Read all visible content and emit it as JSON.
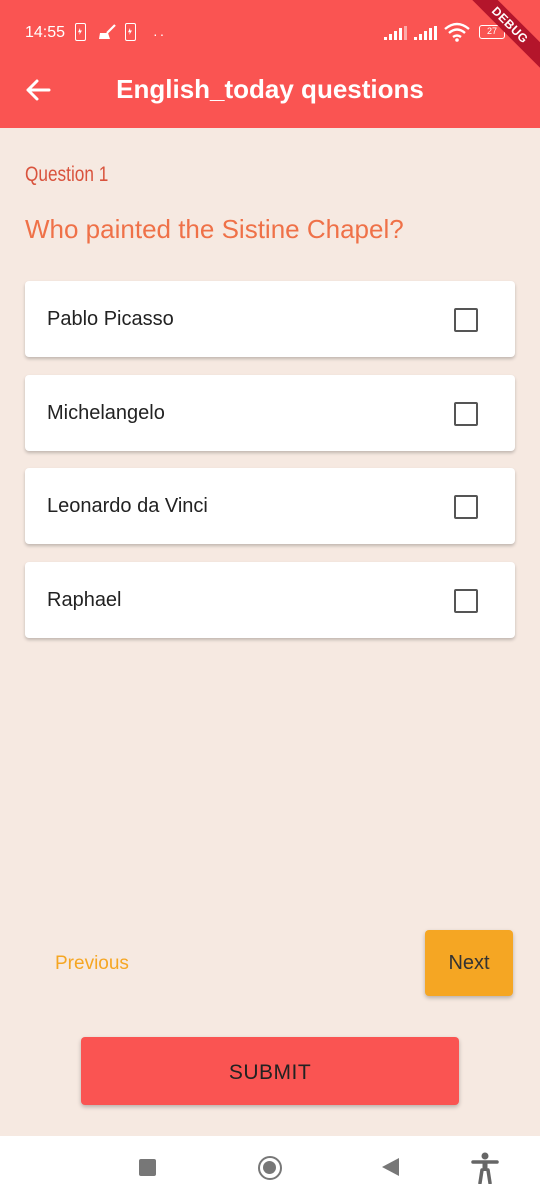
{
  "status_bar": {
    "time": "14:55",
    "battery_level": "27"
  },
  "debug_banner": "DEBUG",
  "app_bar": {
    "title": "English_today questions"
  },
  "question": {
    "number_label": "Question 1",
    "text": "Who painted the Sistine Chapel?"
  },
  "options": [
    {
      "label": "Pablo Picasso",
      "checked": false
    },
    {
      "label": "Michelangelo",
      "checked": false
    },
    {
      "label": "Leonardo da Vinci",
      "checked": false
    },
    {
      "label": "Raphael",
      "checked": false
    }
  ],
  "navigation": {
    "previous_label": "Previous",
    "next_label": "Next"
  },
  "submit_label": "SUBMIT",
  "colors": {
    "app_bar": "#fa5452",
    "background": "#f6e9e1",
    "question_number": "#d9533d",
    "question_text": "#ef7148",
    "accent": "#f5a623",
    "submit": "#fa5452"
  },
  "icons": {
    "back": "arrow-left-icon",
    "checkbox": "checkbox-unchecked-icon",
    "nav_recents": "square-icon",
    "nav_home": "circle-icon",
    "nav_back": "triangle-back-icon",
    "accessibility": "accessibility-icon"
  }
}
